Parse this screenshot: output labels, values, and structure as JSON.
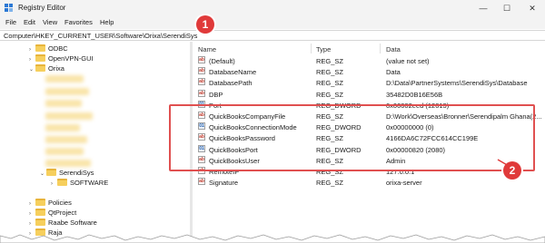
{
  "window": {
    "title": "Registry Editor",
    "minimize": "—",
    "maximize": "☐",
    "close": "✕"
  },
  "menu": [
    "File",
    "Edit",
    "View",
    "Favorites",
    "Help"
  ],
  "address": "Computer\\HKEY_CURRENT_USER\\Software\\Orixa\\SerendiSys",
  "tree": {
    "items": [
      {
        "label": "ODBC",
        "expand": "›"
      },
      {
        "label": "OpenVPN-GUI",
        "expand": "›"
      },
      {
        "label": "Orixa",
        "expand": "⌄"
      },
      {
        "label": "SerendiSys",
        "expand": "⌄"
      },
      {
        "label": "SOFTWARE",
        "expand": "›"
      },
      {
        "label": "Policies",
        "expand": "›"
      },
      {
        "label": "QtProject",
        "expand": "›"
      },
      {
        "label": "Raabe Software",
        "expand": "›"
      },
      {
        "label": "Raja",
        "expand": "›"
      }
    ]
  },
  "columns": [
    "Name",
    "Type",
    "Data"
  ],
  "rows": [
    {
      "name": "(Default)",
      "type": "REG_SZ",
      "data": "(value not set)",
      "icon": "ab"
    },
    {
      "name": "DatabaseName",
      "type": "REG_SZ",
      "data": "Data",
      "icon": "ab"
    },
    {
      "name": "DatabasePath",
      "type": "REG_SZ",
      "data": "D:\\Data\\PartnerSystems\\SerendiSys\\Database",
      "icon": "ab"
    },
    {
      "name": "DBP",
      "type": "REG_SZ",
      "data": "35482D0B16E56B",
      "icon": "ab"
    },
    {
      "name": "Port",
      "type": "REG_DWORD",
      "data": "0x00002eed (12013)",
      "icon": "bin"
    },
    {
      "name": "QuickBooksCompanyFile",
      "type": "REG_SZ",
      "data": "D:\\Work\\Overseas\\Bronner\\Serendipalm Ghana(2...",
      "icon": "ab"
    },
    {
      "name": "QuickBooksConnectionMode",
      "type": "REG_DWORD",
      "data": "0x00000000 (0)",
      "icon": "bin"
    },
    {
      "name": "QuickBooksPassword",
      "type": "REG_SZ",
      "data": "4166DA6C72FCC614CC199E",
      "icon": "ab"
    },
    {
      "name": "QuickBooksPort",
      "type": "REG_DWORD",
      "data": "0x00000820 (2080)",
      "icon": "bin"
    },
    {
      "name": "QuickBooksUser",
      "type": "REG_SZ",
      "data": "Admin",
      "icon": "ab"
    },
    {
      "name": "RemoteIP",
      "type": "REG_SZ",
      "data": "127.0.0.1",
      "icon": "ab"
    },
    {
      "name": "Signature",
      "type": "REG_SZ",
      "data": "orixa-server",
      "icon": "ab"
    }
  ],
  "callouts": [
    "1",
    "2"
  ],
  "colors": {
    "highlight": "#e05050",
    "callout": "#e03a3a",
    "folder": "#f6cf5d"
  }
}
